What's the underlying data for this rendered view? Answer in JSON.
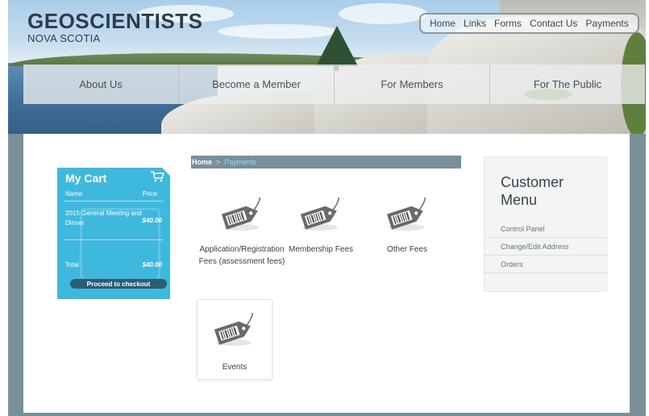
{
  "brand": {
    "name": "GEOSCIENTISTS",
    "region": "NOVA SCOTIA"
  },
  "top_nav": [
    "Home",
    "Links",
    "Forms",
    "Contact Us",
    "Payments"
  ],
  "main_nav": [
    "About Us",
    "Become a Member",
    "For Members",
    "For The Public"
  ],
  "cart": {
    "title": "My Cart",
    "col_name": "Name",
    "col_price": "Price",
    "item_name": "2015 General Meeting and Dinner",
    "item_price": "$40.00",
    "total_label": "Total",
    "total_price": "$40.00",
    "checkout_label": "Proceed to checkout"
  },
  "breadcrumb": {
    "home": "Home",
    "separator": ">",
    "current": "Payments"
  },
  "payment_tiles": [
    {
      "label": "Application/Registration Fees (assessment fees)"
    },
    {
      "label": "Membership Fees"
    },
    {
      "label": "Other Fees"
    },
    {
      "label": "Events"
    }
  ],
  "customer_menu": {
    "title": "Customer Menu",
    "links": [
      "Control Panel",
      "Change/Edit Address",
      "Orders"
    ]
  },
  "colors": {
    "cart_bg": "#3fb8dd",
    "checkout_btn": "#2a5d73",
    "breadcrumb_bg": "#78909a",
    "breadcrumb_current": "#9fdaf0",
    "body_frame": "#7a9099"
  },
  "icons": {
    "cart": "shopping-cart-icon",
    "tile": "price-tag-barcode-icon"
  }
}
